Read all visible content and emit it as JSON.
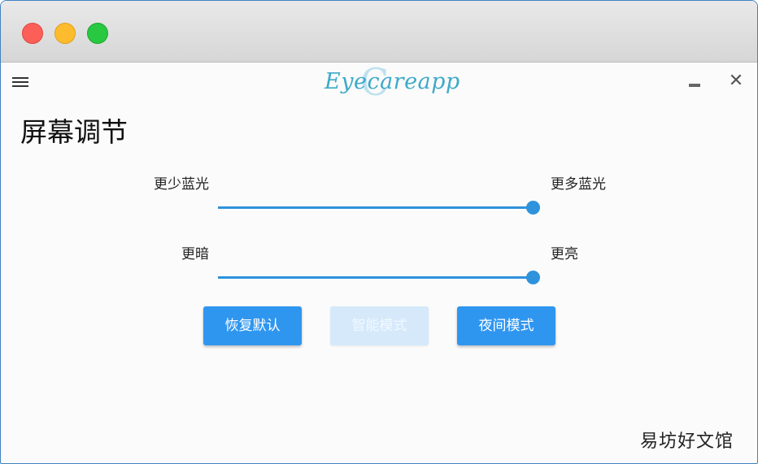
{
  "app": {
    "logo_text": "Eyecareapp",
    "logo_mark": "C"
  },
  "page": {
    "title": "屏幕调节"
  },
  "sliders": [
    {
      "left_label": "更少蓝光",
      "right_label": "更多蓝光",
      "value": 1.0
    },
    {
      "left_label": "更暗",
      "right_label": "更亮",
      "value": 1.0
    }
  ],
  "buttons": {
    "restore_default": "恢复默认",
    "smart_mode": "智能模式",
    "night_mode": "夜间模式"
  },
  "window_controls": {
    "minimize": "minimize-icon",
    "close": "close-icon"
  },
  "watermark": "易坊好文馆",
  "colors": {
    "accent": "#2f96ef",
    "slider": "#2f92dc",
    "disabled_button": "#d5e9fb",
    "logo": "#3ea9c9"
  }
}
